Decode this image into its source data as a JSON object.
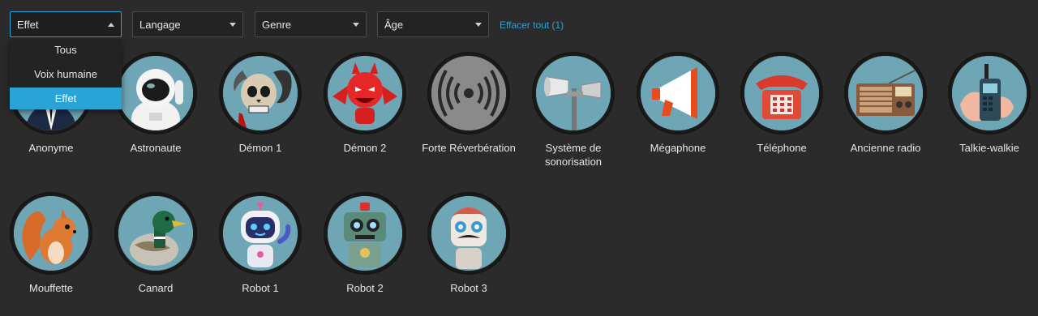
{
  "filters": {
    "effect": {
      "label": "Effet",
      "open": true
    },
    "language": {
      "label": "Langage"
    },
    "gender": {
      "label": "Genre"
    },
    "age": {
      "label": "Âge"
    }
  },
  "clear_all": "Effacer tout (1)",
  "effect_options": [
    {
      "label": "Tous"
    },
    {
      "label": "Voix humaine"
    },
    {
      "label": "Effet",
      "selected": true
    }
  ],
  "voices": [
    {
      "label": "Anonyme",
      "icon": "anonymous-icon"
    },
    {
      "label": "Astronaute",
      "icon": "astronaut-icon"
    },
    {
      "label": "Démon 1",
      "icon": "demon-skull-icon"
    },
    {
      "label": "Démon 2",
      "icon": "red-devil-icon"
    },
    {
      "label": "Forte Réverbération",
      "icon": "reverb-icon"
    },
    {
      "label": "Système de sonorisation",
      "icon": "pa-speaker-icon"
    },
    {
      "label": "Mégaphone",
      "icon": "megaphone-icon"
    },
    {
      "label": "Téléphone",
      "icon": "telephone-icon"
    },
    {
      "label": "Ancienne radio",
      "icon": "old-radio-icon"
    },
    {
      "label": "Talkie-walkie",
      "icon": "walkie-talkie-icon"
    },
    {
      "label": "Mouffette",
      "icon": "squirrel-icon"
    },
    {
      "label": "Canard",
      "icon": "duck-icon"
    },
    {
      "label": "Robot 1",
      "icon": "robot-blue-icon"
    },
    {
      "label": "Robot 2",
      "icon": "robot-green-icon"
    },
    {
      "label": "Robot 3",
      "icon": "robot-mustache-icon"
    }
  ],
  "colors": {
    "accent": "#2aa3d6",
    "background": "#2b2b2b",
    "avatar_bg": "#6fa6b5"
  }
}
